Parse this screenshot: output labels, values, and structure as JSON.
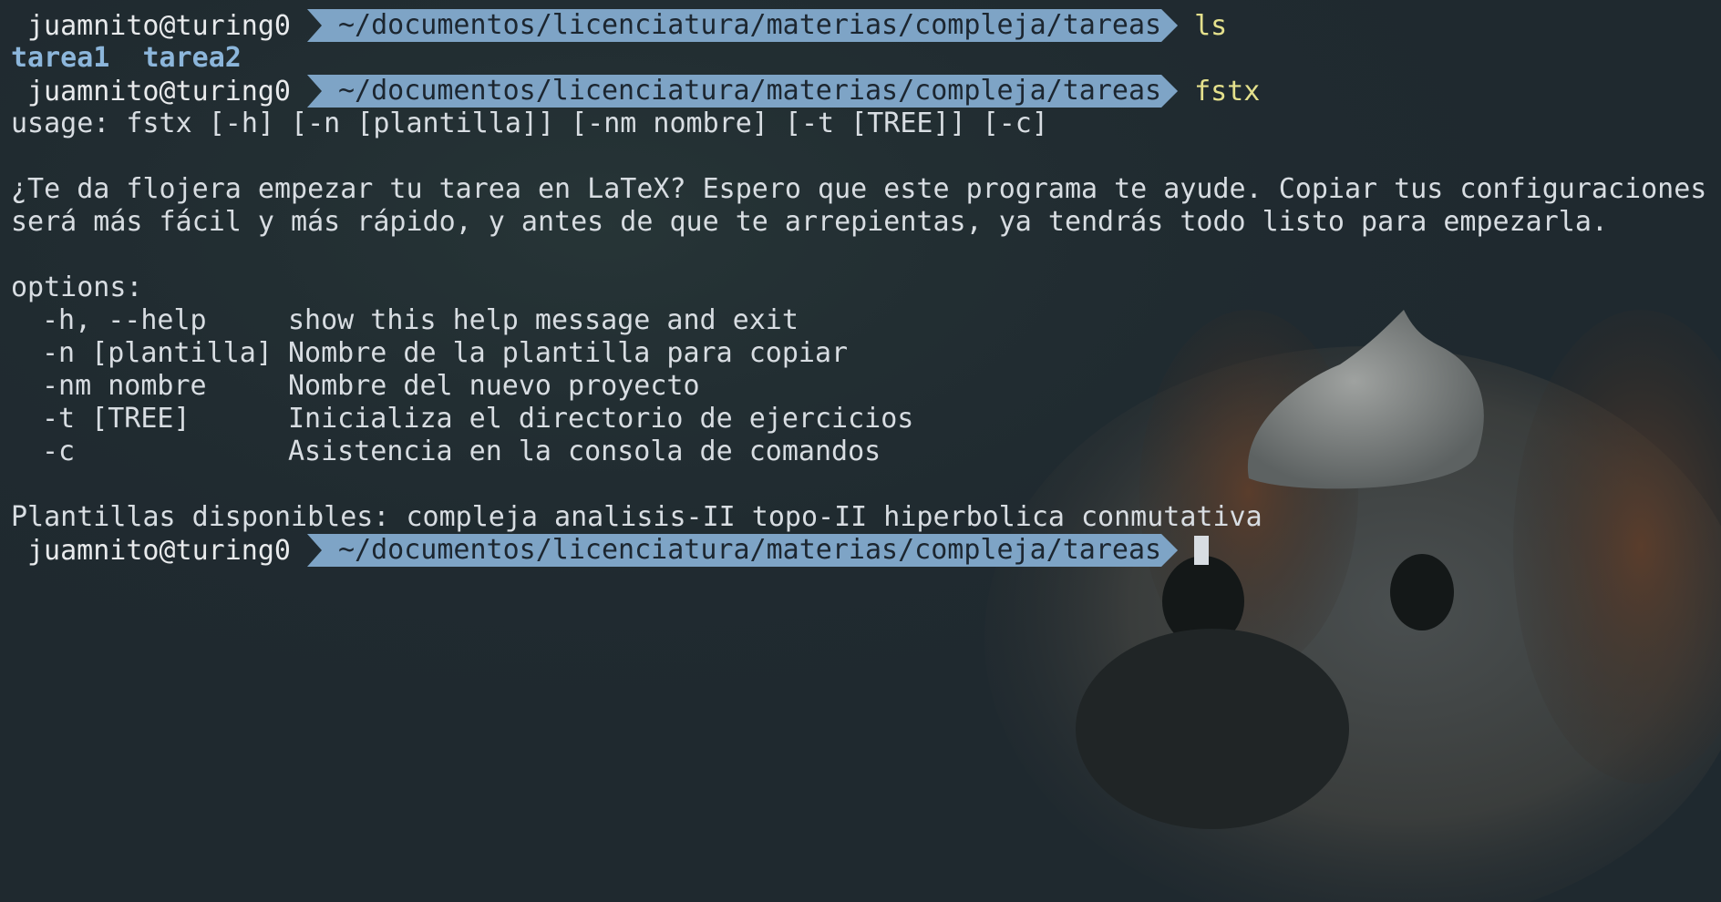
{
  "prompt": {
    "user": "juamnito@turing0",
    "path": "~/documentos/licenciatura/materias/compleja/tareas"
  },
  "commands": {
    "first": "ls",
    "second": "fstx"
  },
  "ls_output": "tarea1  tarea2",
  "usage": "usage: fstx [-h] [-n [plantilla]] [-nm nombre] [-t [TREE]] [-c]",
  "description": [
    "¿Te da flojera empezar tu tarea en LaTeX? Espero que este programa te ayude. Copiar tus configuraciones",
    "será más fácil y más rápido, y antes de que te arrepientas, ya tendrás todo listo para empezarla."
  ],
  "options_header": "options:",
  "options": [
    {
      "flag": "-h, --help",
      "desc": "show this help message and exit"
    },
    {
      "flag": "-n [plantilla]",
      "desc": "Nombre de la plantilla para copiar"
    },
    {
      "flag": "-nm nombre",
      "desc": "Nombre del nuevo proyecto"
    },
    {
      "flag": "-t [TREE]",
      "desc": "Inicializa el directorio de ejercicios"
    },
    {
      "flag": "-c",
      "desc": "Asistencia en la consola de comandos"
    }
  ],
  "plantillas": "Plantillas disponibles: compleja analisis-II topo-II hiperbolica conmutativa",
  "colors": {
    "background": "#1f292f",
    "path_segment": "#7ea4c6",
    "command": "#e4e08c",
    "directory": "#8cb6db",
    "text": "#d8dde2"
  },
  "wallpaper": "dog-with-garlic-on-head"
}
